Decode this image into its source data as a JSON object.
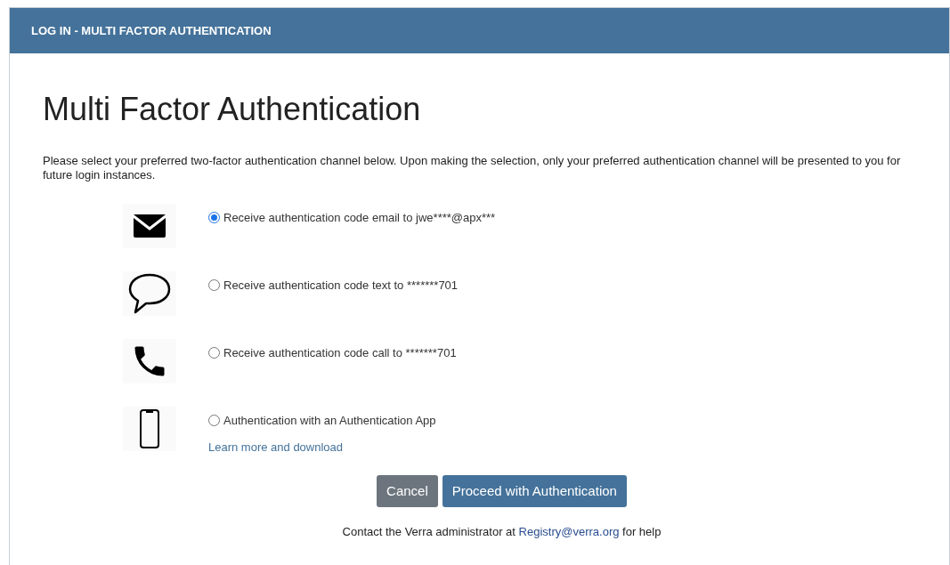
{
  "header": {
    "title": "LOG IN - MULTI FACTOR AUTHENTICATION"
  },
  "heading": "Multi Factor Authentication",
  "intro": "Please select your preferred two-factor authentication channel below. Upon making the selection, only your preferred authentication channel will be presented to you for future login instances.",
  "options": [
    {
      "kind": "envelope",
      "label": "Receive authentication code email to jwe****@apx***",
      "selected": true
    },
    {
      "kind": "speech",
      "label": "Receive authentication code text to *******701",
      "selected": false
    },
    {
      "kind": "phone",
      "label": "Receive authentication code call to *******701",
      "selected": false
    },
    {
      "kind": "smartphone",
      "label": "Authentication with an Authentication App",
      "selected": false,
      "link": "Learn more and download"
    }
  ],
  "buttons": [
    {
      "kind": "secondary",
      "label": "Cancel"
    },
    {
      "kind": "primary",
      "label": "Proceed with Authentication"
    }
  ],
  "footer": {
    "before": "Contact the Verra administrator at",
    "link": "Registry@verra.org",
    "after": "for help"
  }
}
